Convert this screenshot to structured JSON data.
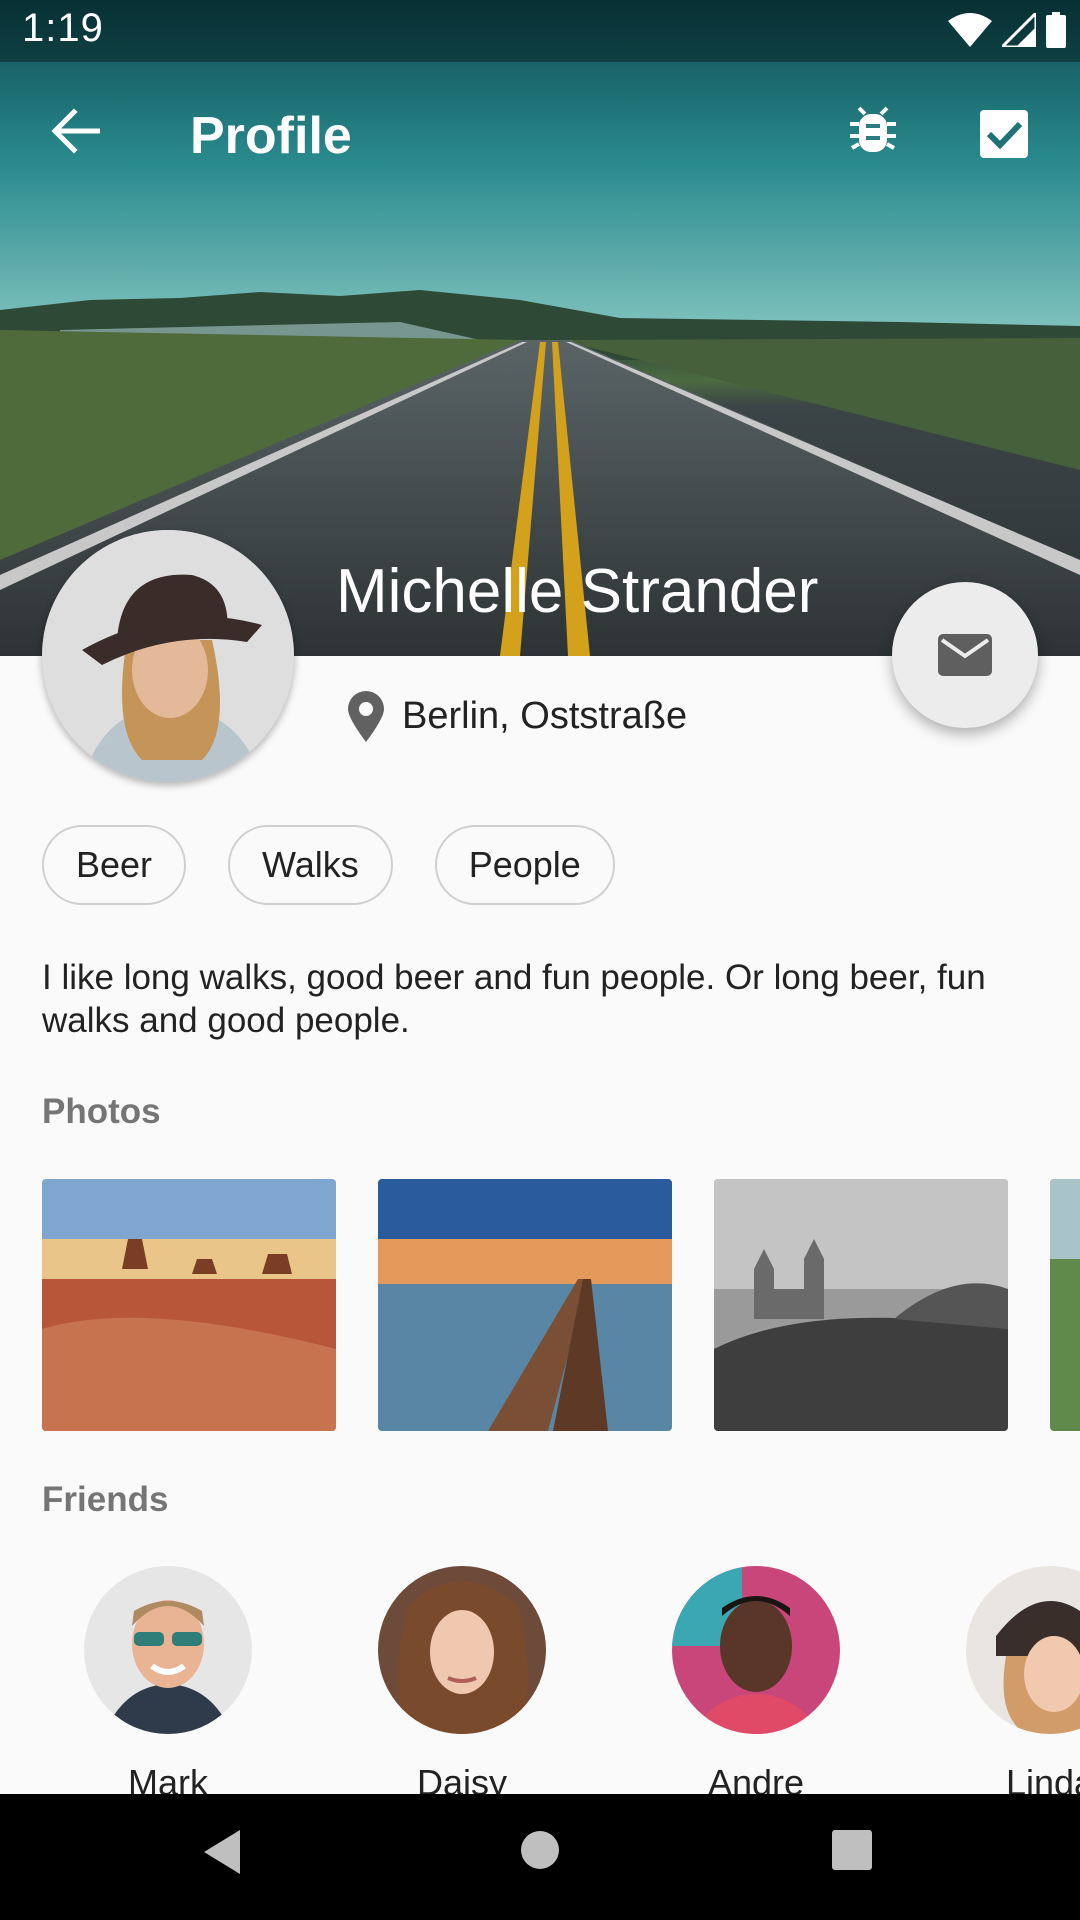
{
  "status_bar": {
    "time": "1:19"
  },
  "appbar": {
    "title": "Profile",
    "back_icon": "arrow-back-icon",
    "actions": [
      "bug-report-icon",
      "check-box-icon"
    ]
  },
  "profile": {
    "name": "Michelle Strander",
    "location": "Berlin, Oststraße",
    "interests": [
      "Beer",
      "Walks",
      "People"
    ],
    "bio": "I like long walks, good beer and fun people. Or long beer, fun walks and good people."
  },
  "sections": {
    "photos_title": "Photos",
    "friends_title": "Friends"
  },
  "friends": [
    {
      "name": "Mark"
    },
    {
      "name": "Daisy"
    },
    {
      "name": "Andre"
    },
    {
      "name": "Linda"
    }
  ],
  "colors": {
    "accent_text": "#757575",
    "chip_border": "#cfcfcf",
    "fab_bg": "#ececec"
  }
}
